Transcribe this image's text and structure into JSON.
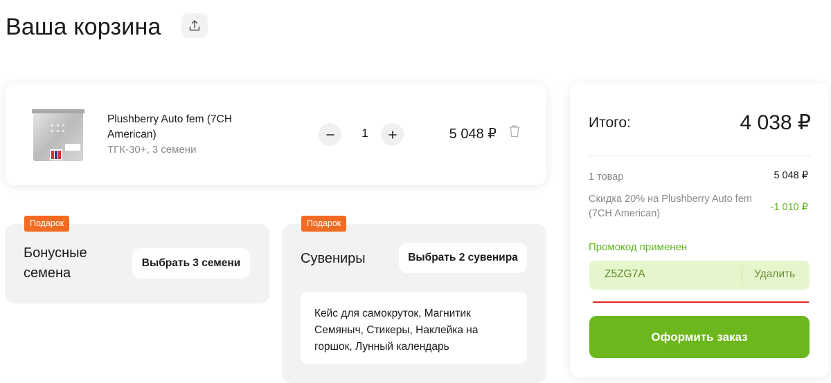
{
  "page": {
    "title": "Ваша корзина"
  },
  "item": {
    "name": "Plushberry Auto fem (7CH American)",
    "meta": "ТГК-30+, 3 семени",
    "quantity": "1",
    "price": "5 048 ₽"
  },
  "gifts": {
    "seeds": {
      "tag": "Подарок",
      "title": "Бонусные семена",
      "button": "Выбрать 3 семени"
    },
    "souvenirs": {
      "tag": "Подарок",
      "title": "Сувениры",
      "button": "Выбрать 2 сувенира",
      "list": "Кейс для самокруток, Магнитик Семяныч, Стикеры, Наклейка на горшок, Лунный календарь"
    }
  },
  "summary": {
    "total_label": "Итого:",
    "total_value": "4 038 ₽",
    "items_label": "1 товар",
    "items_value": "5 048 ₽",
    "discount_label": "Скидка 20% на Plushberry Auto fem (7CH American)",
    "discount_value": "-1 010 ₽",
    "promo_label": "Промокод применен",
    "promo_code": "Z5ZG7A",
    "promo_remove": "Удалить",
    "checkout_label": "Оформить заказ"
  },
  "colors": {
    "accent_green": "#6cb71d",
    "gift_tag": "#f26b22",
    "discount_green": "#5fb41a",
    "error_red": "#e52424"
  },
  "icons": {
    "share": "share-upload-icon",
    "minus": "minus-icon",
    "plus": "plus-icon",
    "trash": "trash-icon"
  }
}
